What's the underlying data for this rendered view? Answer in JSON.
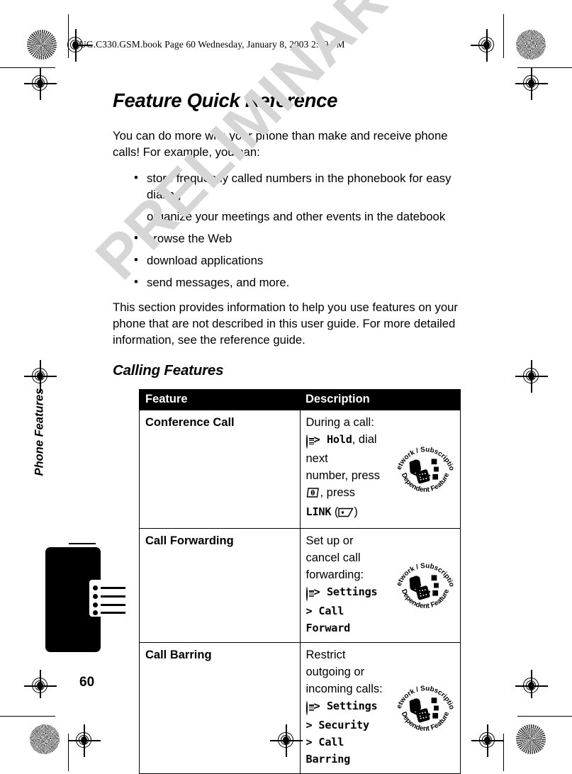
{
  "book_header": "UG.C330.GSM.book  Page 60  Wednesday, January 8, 2003  2:00 PM",
  "watermark": "PRELIMINARY",
  "page_number": "60",
  "sidebar": {
    "section_label": "Phone Features",
    "tab_icon": "list-lines-icon"
  },
  "content": {
    "title": "Feature Quick Reference",
    "intro": "You can do more with your phone than make and receive phone calls! For example, you can:",
    "bullets": [
      "store frequently called numbers in the phonebook for easy dialing",
      "organize your meetings and other events in the datebook",
      "browse the Web",
      "download applications",
      "send messages, and more."
    ],
    "closing": "This section provides information to help you use features on your phone that are not described in this user guide. For more detailed information, see the reference guide.",
    "subtitle": "Calling Features"
  },
  "table": {
    "headers": [
      "Feature",
      "Description"
    ],
    "rows": [
      {
        "feature": "Conference Call",
        "desc_line1": "During a call:",
        "menu_icon": "menu-key-icon",
        "desc_line2_pre": " > ",
        "desc_line2_mono": "Hold",
        "desc_line2_post": ", dial next",
        "desc_line3_pre": "number, press ",
        "send_icon": "send-key-icon",
        "desc_line3_post": ", press",
        "desc_line4_mono": "LINK",
        "desc_line4_paren_open": " (",
        "soft_icon": "soft-key-icon",
        "desc_line4_paren_close": ")",
        "badge": "network-subscription-dependent-feature-icon"
      },
      {
        "feature": "Call Forwarding",
        "desc_line1": "Set up or cancel call",
        "desc_line2": "forwarding:",
        "menu_icon": "menu-key-icon",
        "desc_line3_pre": " > ",
        "desc_line3_mono": "Settings",
        "desc_line4": "> Call Forward",
        "badge": "network-subscription-dependent-feature-icon"
      },
      {
        "feature": "Call Barring",
        "desc_line1": "Restrict outgoing or",
        "desc_line2": "incoming calls:",
        "menu_icon": "menu-key-icon",
        "desc_line3_pre": " > ",
        "desc_line3_mono": "Settings > Security",
        "desc_line4": "> Call Barring",
        "badge": "network-subscription-dependent-feature-icon"
      }
    ]
  },
  "badge_text": {
    "top": "Network / Subscription",
    "bottom": "Dependent Feature"
  },
  "colors": {
    "ink": "#000000",
    "paper": "#ffffff",
    "watermark": "#d6d6d6"
  }
}
